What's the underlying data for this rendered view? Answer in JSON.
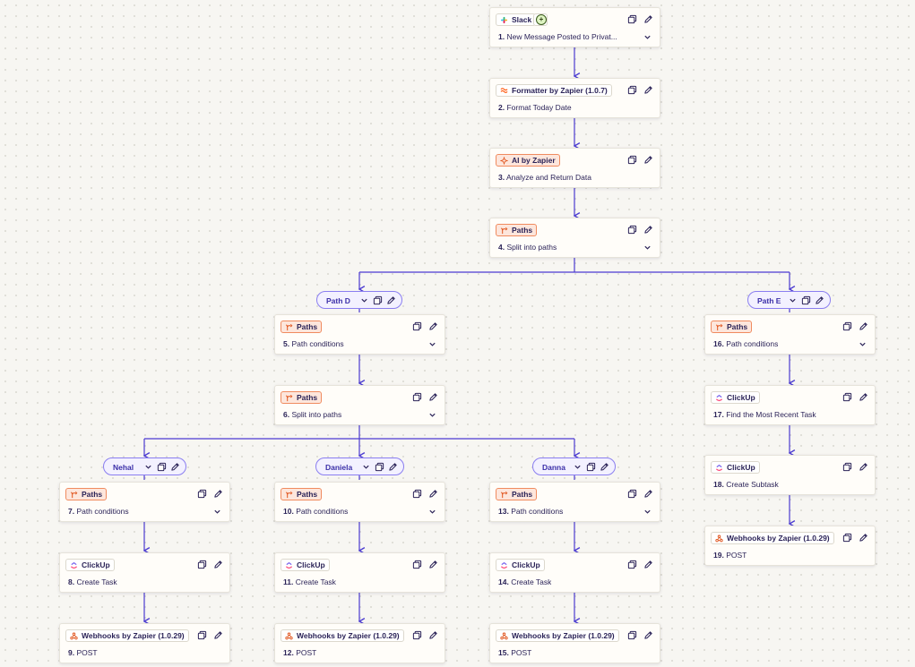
{
  "steps": [
    {
      "id": "s1",
      "badge": "Slack",
      "icon": "slack-icon",
      "num": "1.",
      "title": "New Message Posted to Privat...",
      "chevron": true,
      "plus": true,
      "orange": false
    },
    {
      "id": "s2",
      "badge": "Formatter by Zapier (1.0.7)",
      "icon": "formatter-icon",
      "num": "2.",
      "title": "Format Today Date",
      "chevron": false,
      "orange": false
    },
    {
      "id": "s3",
      "badge": "AI by Zapier",
      "icon": "ai-sparkle-icon",
      "num": "3.",
      "title": "Analyze and Return Data",
      "chevron": false,
      "orange": true
    },
    {
      "id": "s4",
      "badge": "Paths",
      "icon": "paths-icon",
      "num": "4.",
      "title": "Split into paths",
      "chevron": true,
      "orange": true
    },
    {
      "id": "s5",
      "badge": "Paths",
      "icon": "paths-icon",
      "num": "5.",
      "title": "Path conditions",
      "chevron": true,
      "orange": true
    },
    {
      "id": "s6",
      "badge": "Paths",
      "icon": "paths-icon",
      "num": "6.",
      "title": "Split into paths",
      "chevron": true,
      "orange": true
    },
    {
      "id": "s7",
      "badge": "Paths",
      "icon": "paths-icon",
      "num": "7.",
      "title": "Path conditions",
      "chevron": true,
      "orange": true
    },
    {
      "id": "s8",
      "badge": "ClickUp",
      "icon": "clickup-icon",
      "num": "8.",
      "title": "Create Task",
      "chevron": false,
      "orange": false
    },
    {
      "id": "s9",
      "badge": "Webhooks by Zapier (1.0.29)",
      "icon": "webhooks-icon",
      "num": "9.",
      "title": "POST",
      "chevron": false,
      "orange": false
    },
    {
      "id": "s10",
      "badge": "Paths",
      "icon": "paths-icon",
      "num": "10.",
      "title": "Path conditions",
      "chevron": true,
      "orange": true
    },
    {
      "id": "s11",
      "badge": "ClickUp",
      "icon": "clickup-icon",
      "num": "11.",
      "title": "Create Task",
      "chevron": false,
      "orange": false
    },
    {
      "id": "s12",
      "badge": "Webhooks by Zapier (1.0.29)",
      "icon": "webhooks-icon",
      "num": "12.",
      "title": "POST",
      "chevron": false,
      "orange": false
    },
    {
      "id": "s13",
      "badge": "Paths",
      "icon": "paths-icon",
      "num": "13.",
      "title": "Path conditions",
      "chevron": true,
      "orange": true
    },
    {
      "id": "s14",
      "badge": "ClickUp",
      "icon": "clickup-icon",
      "num": "14.",
      "title": "Create Task",
      "chevron": false,
      "orange": false
    },
    {
      "id": "s15",
      "badge": "Webhooks by Zapier (1.0.29)",
      "icon": "webhooks-icon",
      "num": "15.",
      "title": "POST",
      "chevron": false,
      "orange": false
    },
    {
      "id": "s16",
      "badge": "Paths",
      "icon": "paths-icon",
      "num": "16.",
      "title": "Path conditions",
      "chevron": true,
      "orange": true
    },
    {
      "id": "s17",
      "badge": "ClickUp",
      "icon": "clickup-icon",
      "num": "17.",
      "title": "Find the Most Recent Task",
      "chevron": false,
      "orange": false
    },
    {
      "id": "s18",
      "badge": "ClickUp",
      "icon": "clickup-icon",
      "num": "18.",
      "title": "Create Subtask",
      "chevron": false,
      "orange": false
    },
    {
      "id": "s19",
      "badge": "Webhooks by Zapier (1.0.29)",
      "icon": "webhooks-icon",
      "num": "19.",
      "title": "POST",
      "chevron": false,
      "orange": false
    }
  ],
  "paths": [
    {
      "id": "pD",
      "label": "Path D"
    },
    {
      "id": "pE",
      "label": "Path E"
    },
    {
      "id": "pNehal",
      "label": "Nehal"
    },
    {
      "id": "pDaniela",
      "label": "Daniela"
    },
    {
      "id": "pDanna",
      "label": "Danna"
    }
  ],
  "colors": {
    "connector": "#4b3bd1",
    "pill_border": "#8a7ef0",
    "orange_badge_bg": "#fde6dc",
    "orange_badge_border": "#f08b5f",
    "card_bg": "#fffdf9"
  }
}
